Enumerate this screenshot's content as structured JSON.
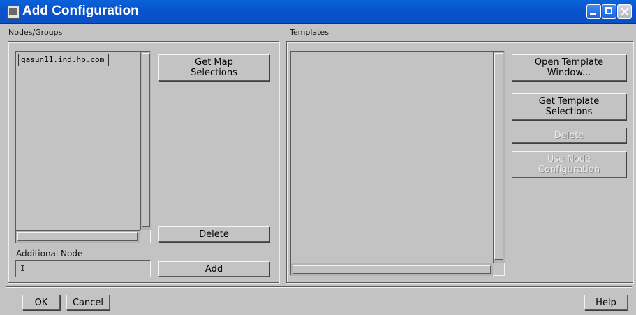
{
  "window": {
    "title": "Add Configuration"
  },
  "nodes_groups": {
    "label": "Nodes/Groups",
    "items": [
      "qasun11.ind.hp.com"
    ],
    "get_map_selections": "Get Map\nSelections",
    "delete": "Delete",
    "additional_node_label": "Additional Node",
    "additional_node_value": "",
    "add": "Add"
  },
  "templates": {
    "label": "Templates",
    "open_template_window": "Open Template\nWindow...",
    "get_template_selections": "Get Template\nSelections",
    "delete": "Delete",
    "use_node_configuration": "Use Node\nConfiguration"
  },
  "footer": {
    "ok": "OK",
    "cancel": "Cancel",
    "help": "Help"
  }
}
